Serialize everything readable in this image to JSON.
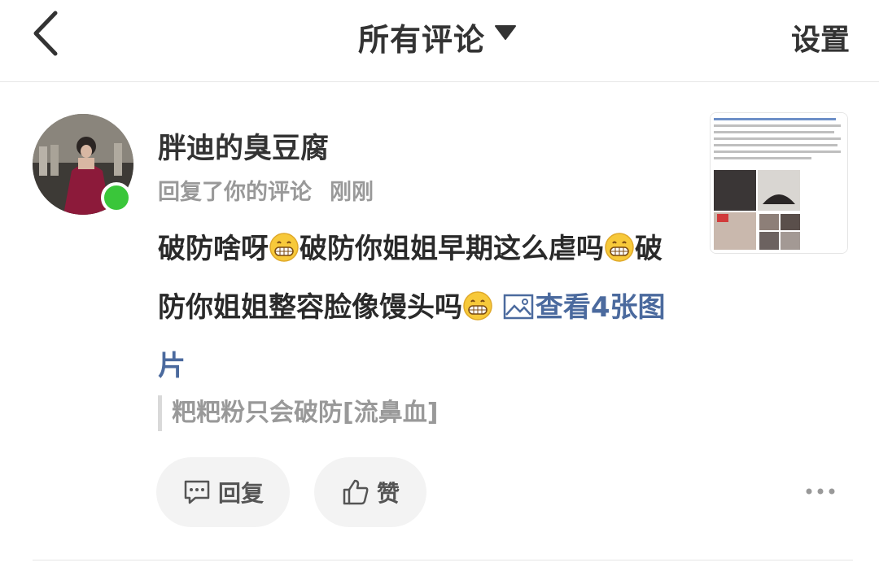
{
  "header": {
    "back_icon": "chevron-left-icon",
    "title": "所有评论",
    "dropdown_icon": "triangle-down-icon",
    "settings_label": "设置"
  },
  "notification": {
    "username": "胖迪的臭豆腐",
    "action": "回复了你的评论",
    "time": "刚刚",
    "online_color": "#3ac63a",
    "comment": {
      "part1": "破防啥呀",
      "part2": "破防你姐姐早期这么虐吗",
      "part3": "破防你姐姐整容脸像馒头吗",
      "emoji_icon": "grinning-emoji-icon",
      "view_images_label": "查看4张图片"
    },
    "quoted_text": "粑粑粉只会破防[流鼻血]",
    "reply_label": "回复",
    "like_label": "赞",
    "more_icon": "more-dots-icon",
    "link_color": "#4b6a9e"
  }
}
